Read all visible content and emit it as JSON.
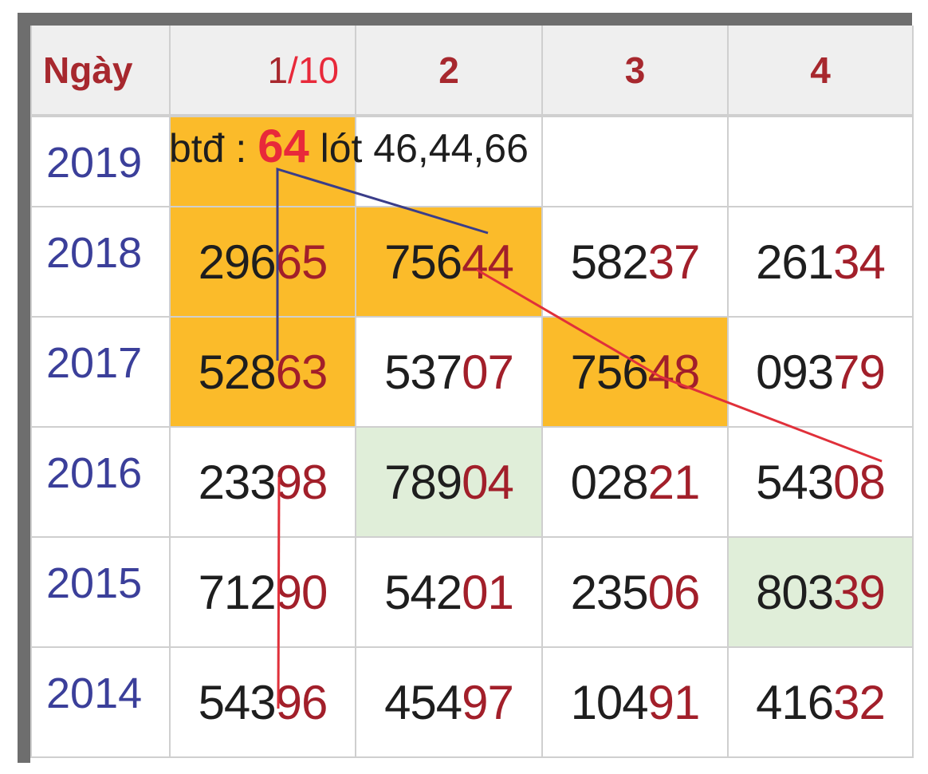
{
  "table": {
    "header": [
      "Ngày",
      "1/10",
      "2",
      "3",
      "4"
    ],
    "date_header": {
      "day": "1",
      "sep": "/",
      "month": "10"
    },
    "rows": [
      {
        "year": "2019",
        "cells": [
          "",
          "",
          "",
          ""
        ]
      },
      {
        "year": "2018",
        "cells": [
          {
            "head": "296",
            "tail": "65"
          },
          {
            "head": "756",
            "tail": "44"
          },
          {
            "head": "582",
            "tail": "37"
          },
          {
            "head": "261",
            "tail": "34"
          }
        ]
      },
      {
        "year": "2017",
        "cells": [
          {
            "head": "528",
            "tail": "63"
          },
          {
            "head": "537",
            "tail": "07"
          },
          {
            "head": "756",
            "tail": "48"
          },
          {
            "head": "093",
            "tail": "79"
          }
        ]
      },
      {
        "year": "2016",
        "cells": [
          {
            "head": "233",
            "tail": "98"
          },
          {
            "head": "789",
            "tail": "04"
          },
          {
            "head": "028",
            "tail": "21"
          },
          {
            "head": "543",
            "tail": "08"
          }
        ]
      },
      {
        "year": "2015",
        "cells": [
          {
            "head": "712",
            "tail": "90"
          },
          {
            "head": "542",
            "tail": "01"
          },
          {
            "head": "235",
            "tail": "06"
          },
          {
            "head": "803",
            "tail": "39"
          }
        ]
      },
      {
        "year": "2014",
        "cells": [
          {
            "head": "543",
            "tail": "96"
          },
          {
            "head": "454",
            "tail": "97"
          },
          {
            "head": "104",
            "tail": "91"
          },
          {
            "head": "416",
            "tail": "32"
          }
        ]
      }
    ]
  },
  "annotation": {
    "prefix": "btđ : ",
    "highlight": "64",
    "suffix": " lót 46,44,66"
  },
  "colors": {
    "header_text": "#a7282e",
    "year_text": "#3b3f9a",
    "tail_digits": "#a21f2a",
    "highlight_orange": "#fbbb2a",
    "highlight_green": "#e0eed9",
    "line_blue": "#3a3d8a",
    "line_red": "#e0303a"
  }
}
